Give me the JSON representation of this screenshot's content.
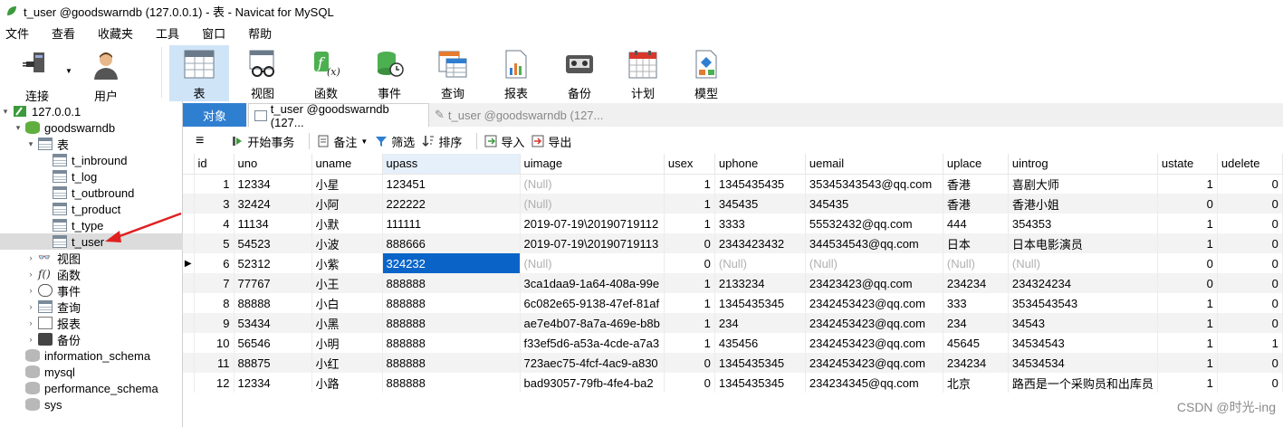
{
  "window": {
    "title": "t_user @goodswarndb (127.0.0.1) - 表 - Navicat for MySQL"
  },
  "menu": [
    "文件",
    "查看",
    "收藏夹",
    "工具",
    "窗口",
    "帮助"
  ],
  "toolbar": {
    "connect": "连接",
    "user": "用户",
    "items": [
      {
        "label": "表",
        "icon": "table-icon",
        "active": true
      },
      {
        "label": "视图",
        "icon": "view-icon"
      },
      {
        "label": "函数",
        "icon": "function-icon"
      },
      {
        "label": "事件",
        "icon": "event-icon"
      },
      {
        "label": "查询",
        "icon": "query-icon"
      },
      {
        "label": "报表",
        "icon": "report-icon"
      },
      {
        "label": "备份",
        "icon": "backup-icon"
      },
      {
        "label": "计划",
        "icon": "schedule-icon"
      },
      {
        "label": "模型",
        "icon": "model-icon"
      }
    ]
  },
  "tree": {
    "server": "127.0.0.1",
    "database": "goodswarndb",
    "tables_group": "表",
    "tables": [
      "t_inbround",
      "t_log",
      "t_outbround",
      "t_product",
      "t_type",
      "t_user"
    ],
    "selected_table": "t_user",
    "groups": [
      {
        "label": "视图",
        "icon": "view-icon"
      },
      {
        "label": "函数",
        "icon": "function-icon"
      },
      {
        "label": "事件",
        "icon": "event-icon"
      },
      {
        "label": "查询",
        "icon": "query-icon"
      },
      {
        "label": "报表",
        "icon": "report-icon"
      },
      {
        "label": "备份",
        "icon": "backup-icon"
      }
    ],
    "other_databases": [
      "information_schema",
      "mysql",
      "performance_schema",
      "sys"
    ]
  },
  "tabs": {
    "objects": "对象",
    "tab1": "t_user @goodswarndb (127...",
    "tab2": "t_user @goodswarndb (127..."
  },
  "gridbar": {
    "begin_transaction": "开始事务",
    "memo": "备注",
    "filter": "筛选",
    "sort": "排序",
    "import": "导入",
    "export": "导出"
  },
  "grid": {
    "columns": [
      "id",
      "uno",
      "uname",
      "upass",
      "uimage",
      "usex",
      "uphone",
      "uemail",
      "uplace",
      "uintrog",
      "ustate",
      "udelete"
    ],
    "rows": [
      [
        "1",
        "12334",
        "小星",
        "123451",
        "(Null)",
        "1",
        "1345435435",
        "35345343543@qq.com",
        "香港",
        "喜剧大师",
        "1",
        "0"
      ],
      [
        "3",
        "32424",
        "小阿",
        "222222",
        "(Null)",
        "1",
        "345435",
        "345435",
        "香港",
        "香港小姐",
        "0",
        "0"
      ],
      [
        "4",
        "11134",
        "小默",
        "111111",
        "2019-07-19\\20190719112",
        "1",
        "3333",
        "55532432@qq.com",
        "444",
        "354353",
        "1",
        "0"
      ],
      [
        "5",
        "54523",
        "小波",
        "888666",
        "2019-07-19\\20190719113",
        "0",
        "2343423432",
        "344534543@qq.com",
        "日本",
        "日本电影演员",
        "1",
        "0"
      ],
      [
        "6",
        "52312",
        "小紫",
        "324232",
        "(Null)",
        "0",
        "(Null)",
        "(Null)",
        "(Null)",
        "(Null)",
        "0",
        "0"
      ],
      [
        "7",
        "77767",
        "小王",
        "888888",
        "3ca1daa9-1a64-408a-99e",
        "1",
        "2133234",
        "23423423@qq.com",
        "234234",
        "234324234",
        "0",
        "0"
      ],
      [
        "8",
        "88888",
        "小白",
        "888888",
        "6c082e65-9138-47ef-81af",
        "1",
        "1345435345",
        "2342453423@qq.com",
        "333",
        "3534543543",
        "1",
        "0"
      ],
      [
        "9",
        "53434",
        "小黑",
        "888888",
        "ae7e4b07-8a7a-469e-b8b",
        "1",
        "234",
        "2342453423@qq.com",
        "234",
        "34543",
        "1",
        "0"
      ],
      [
        "10",
        "56546",
        "小明",
        "888888",
        "f33ef5d6-a53a-4cde-a7a3",
        "1",
        "435456",
        "2342453423@qq.com",
        "45645",
        "34534543",
        "1",
        "1"
      ],
      [
        "11",
        "88875",
        "小红",
        "888888",
        "723aec75-4fcf-4ac9-a830",
        "0",
        "1345435345",
        "2342453423@qq.com",
        "234234",
        "34534534",
        "1",
        "0"
      ],
      [
        "12",
        "12334",
        "小路",
        "888888",
        "bad93057-79fb-4fe4-ba2",
        "0",
        "1345435345",
        "234234345@qq.com",
        "北京",
        "路西是一个采购员和出库员",
        "1",
        "0"
      ]
    ],
    "current_row_index": 4,
    "current_col": "upass"
  },
  "watermark": "CSDN @时光-ing",
  "colors": {
    "accent": "#2f7fd1",
    "selected_cell": "#0a64c8",
    "tree_selected": "#dcdcdc",
    "arrow": "#e02020"
  }
}
